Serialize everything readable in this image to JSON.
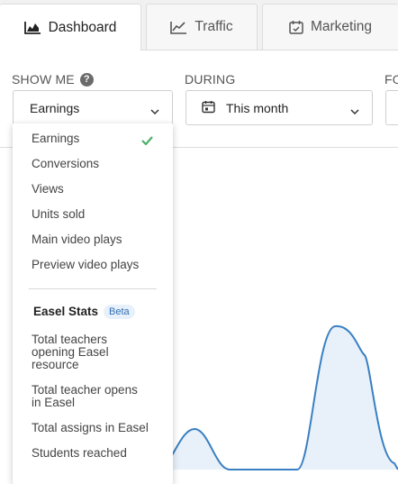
{
  "tabs": [
    {
      "label": "Dashboard",
      "icon": "area-chart-icon",
      "active": true
    },
    {
      "label": "Traffic",
      "icon": "line-chart-icon",
      "active": false
    },
    {
      "label": "Marketing",
      "icon": "calendar-check-icon",
      "active": false
    }
  ],
  "filters": {
    "show_me": {
      "label": "SHOW ME",
      "value": "Earnings"
    },
    "during": {
      "label": "DURING",
      "value": "This month"
    },
    "third_label": "FO"
  },
  "dropdown": {
    "items": [
      {
        "label": "Earnings",
        "selected": true
      },
      {
        "label": "Conversions"
      },
      {
        "label": "Views"
      },
      {
        "label": "Units sold"
      },
      {
        "label": "Main video plays"
      },
      {
        "label": "Preview video plays"
      }
    ],
    "section_heading": "Easel Stats",
    "section_badge": "Beta",
    "section_items": [
      {
        "label": "Total teachers opening Easel resource"
      },
      {
        "label": "Total teacher opens in Easel"
      },
      {
        "label": "Total assigns in Easel"
      },
      {
        "label": "Students reached"
      }
    ]
  },
  "colors": {
    "accent_line": "#3a7fc1",
    "area_fill": "#e8f1fa",
    "check": "#4caf6a",
    "badge_text": "#2f6fb5"
  }
}
